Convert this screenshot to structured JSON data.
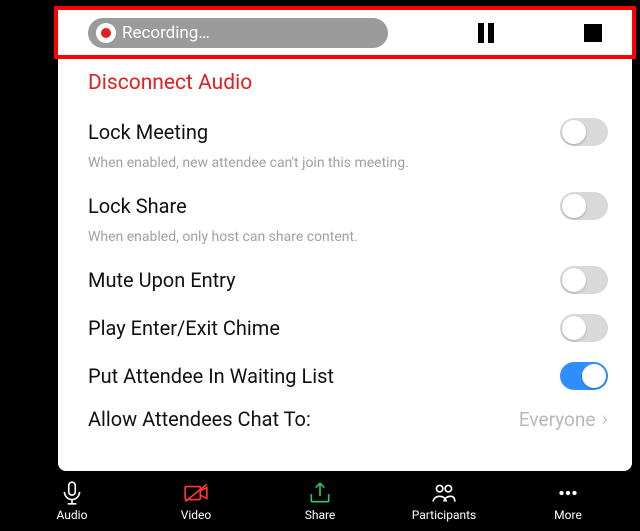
{
  "topbar": {
    "recording_label": "Recording…"
  },
  "panel": {
    "disconnect": "Disconnect Audio",
    "lock_meeting": {
      "title": "Lock Meeting",
      "desc": "When enabled, new attendee can't join this meeting."
    },
    "lock_share": {
      "title": "Lock Share",
      "desc": "When enabled, only host can share content."
    },
    "mute_entry": {
      "title": "Mute Upon Entry"
    },
    "chime": {
      "title": "Play Enter/Exit Chime"
    },
    "waiting": {
      "title": "Put Attendee In Waiting List"
    },
    "chat": {
      "title": "Allow Attendees Chat To:",
      "value": "Everyone"
    }
  },
  "toolbar": {
    "audio": "Audio",
    "video": "Video",
    "share": "Share",
    "participants": "Participants",
    "more": "More"
  }
}
